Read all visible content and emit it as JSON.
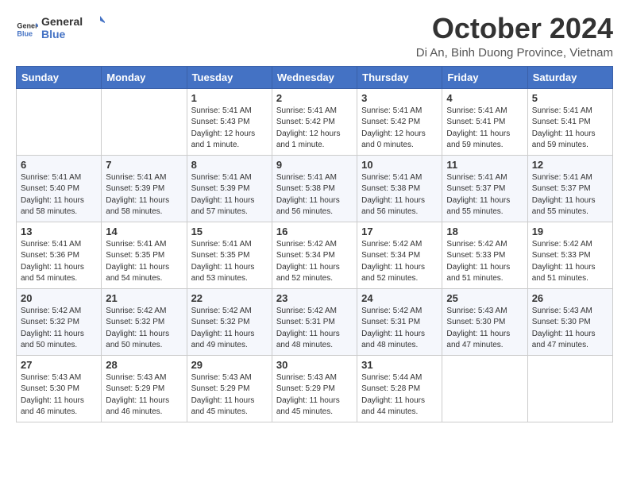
{
  "logo": {
    "line1": "General",
    "line2": "Blue"
  },
  "title": "October 2024",
  "subtitle": "Di An, Binh Duong Province, Vietnam",
  "days_of_week": [
    "Sunday",
    "Monday",
    "Tuesday",
    "Wednesday",
    "Thursday",
    "Friday",
    "Saturday"
  ],
  "weeks": [
    [
      {
        "day": "",
        "info": ""
      },
      {
        "day": "",
        "info": ""
      },
      {
        "day": "1",
        "info": "Sunrise: 5:41 AM\nSunset: 5:43 PM\nDaylight: 12 hours\nand 1 minute."
      },
      {
        "day": "2",
        "info": "Sunrise: 5:41 AM\nSunset: 5:42 PM\nDaylight: 12 hours\nand 1 minute."
      },
      {
        "day": "3",
        "info": "Sunrise: 5:41 AM\nSunset: 5:42 PM\nDaylight: 12 hours\nand 0 minutes."
      },
      {
        "day": "4",
        "info": "Sunrise: 5:41 AM\nSunset: 5:41 PM\nDaylight: 11 hours\nand 59 minutes."
      },
      {
        "day": "5",
        "info": "Sunrise: 5:41 AM\nSunset: 5:41 PM\nDaylight: 11 hours\nand 59 minutes."
      }
    ],
    [
      {
        "day": "6",
        "info": "Sunrise: 5:41 AM\nSunset: 5:40 PM\nDaylight: 11 hours\nand 58 minutes."
      },
      {
        "day": "7",
        "info": "Sunrise: 5:41 AM\nSunset: 5:39 PM\nDaylight: 11 hours\nand 58 minutes."
      },
      {
        "day": "8",
        "info": "Sunrise: 5:41 AM\nSunset: 5:39 PM\nDaylight: 11 hours\nand 57 minutes."
      },
      {
        "day": "9",
        "info": "Sunrise: 5:41 AM\nSunset: 5:38 PM\nDaylight: 11 hours\nand 56 minutes."
      },
      {
        "day": "10",
        "info": "Sunrise: 5:41 AM\nSunset: 5:38 PM\nDaylight: 11 hours\nand 56 minutes."
      },
      {
        "day": "11",
        "info": "Sunrise: 5:41 AM\nSunset: 5:37 PM\nDaylight: 11 hours\nand 55 minutes."
      },
      {
        "day": "12",
        "info": "Sunrise: 5:41 AM\nSunset: 5:37 PM\nDaylight: 11 hours\nand 55 minutes."
      }
    ],
    [
      {
        "day": "13",
        "info": "Sunrise: 5:41 AM\nSunset: 5:36 PM\nDaylight: 11 hours\nand 54 minutes."
      },
      {
        "day": "14",
        "info": "Sunrise: 5:41 AM\nSunset: 5:35 PM\nDaylight: 11 hours\nand 54 minutes."
      },
      {
        "day": "15",
        "info": "Sunrise: 5:41 AM\nSunset: 5:35 PM\nDaylight: 11 hours\nand 53 minutes."
      },
      {
        "day": "16",
        "info": "Sunrise: 5:42 AM\nSunset: 5:34 PM\nDaylight: 11 hours\nand 52 minutes."
      },
      {
        "day": "17",
        "info": "Sunrise: 5:42 AM\nSunset: 5:34 PM\nDaylight: 11 hours\nand 52 minutes."
      },
      {
        "day": "18",
        "info": "Sunrise: 5:42 AM\nSunset: 5:33 PM\nDaylight: 11 hours\nand 51 minutes."
      },
      {
        "day": "19",
        "info": "Sunrise: 5:42 AM\nSunset: 5:33 PM\nDaylight: 11 hours\nand 51 minutes."
      }
    ],
    [
      {
        "day": "20",
        "info": "Sunrise: 5:42 AM\nSunset: 5:32 PM\nDaylight: 11 hours\nand 50 minutes."
      },
      {
        "day": "21",
        "info": "Sunrise: 5:42 AM\nSunset: 5:32 PM\nDaylight: 11 hours\nand 50 minutes."
      },
      {
        "day": "22",
        "info": "Sunrise: 5:42 AM\nSunset: 5:32 PM\nDaylight: 11 hours\nand 49 minutes."
      },
      {
        "day": "23",
        "info": "Sunrise: 5:42 AM\nSunset: 5:31 PM\nDaylight: 11 hours\nand 48 minutes."
      },
      {
        "day": "24",
        "info": "Sunrise: 5:42 AM\nSunset: 5:31 PM\nDaylight: 11 hours\nand 48 minutes."
      },
      {
        "day": "25",
        "info": "Sunrise: 5:43 AM\nSunset: 5:30 PM\nDaylight: 11 hours\nand 47 minutes."
      },
      {
        "day": "26",
        "info": "Sunrise: 5:43 AM\nSunset: 5:30 PM\nDaylight: 11 hours\nand 47 minutes."
      }
    ],
    [
      {
        "day": "27",
        "info": "Sunrise: 5:43 AM\nSunset: 5:30 PM\nDaylight: 11 hours\nand 46 minutes."
      },
      {
        "day": "28",
        "info": "Sunrise: 5:43 AM\nSunset: 5:29 PM\nDaylight: 11 hours\nand 46 minutes."
      },
      {
        "day": "29",
        "info": "Sunrise: 5:43 AM\nSunset: 5:29 PM\nDaylight: 11 hours\nand 45 minutes."
      },
      {
        "day": "30",
        "info": "Sunrise: 5:43 AM\nSunset: 5:29 PM\nDaylight: 11 hours\nand 45 minutes."
      },
      {
        "day": "31",
        "info": "Sunrise: 5:44 AM\nSunset: 5:28 PM\nDaylight: 11 hours\nand 44 minutes."
      },
      {
        "day": "",
        "info": ""
      },
      {
        "day": "",
        "info": ""
      }
    ]
  ]
}
